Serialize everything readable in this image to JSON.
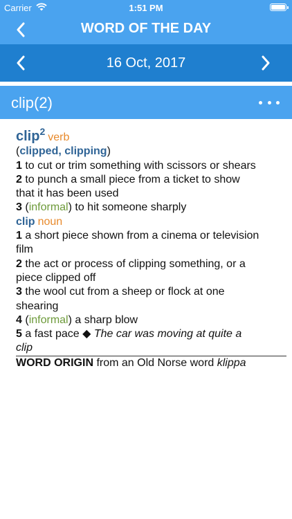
{
  "status": {
    "carrier": "Carrier",
    "time": "1:51 PM",
    "wifi_icon": "wifi-icon",
    "battery_icon": "battery-icon"
  },
  "nav": {
    "title": "WORD OF THE DAY",
    "back_icon": "chevron-left-icon"
  },
  "date_bar": {
    "date": "16 Oct, 2017",
    "prev_icon": "chevron-left-icon",
    "next_icon": "chevron-right-icon"
  },
  "entry": {
    "headword": "clip(2)",
    "more_icon": "more-horizontal-icon"
  },
  "definition": {
    "word": "clip",
    "superscript": "2",
    "pos_verb": "verb",
    "forms_open": "(",
    "forms": "clipped, clipping",
    "forms_close": ")",
    "senses_verb": [
      {
        "num": "1",
        "text": "to cut or trim something with scissors or shears"
      },
      {
        "num": "2",
        "text": "to punch a small piece from a ticket to show",
        "text2": "that it has been used"
      },
      {
        "num": "3",
        "label": "informal",
        "text": "to hit someone sharply"
      }
    ],
    "noun_word": "clip",
    "pos_noun": "noun",
    "senses_noun": [
      {
        "num": "1",
        "text": "a short piece shown from a cinema or television",
        "text2": "film"
      },
      {
        "num": "2",
        "text": "the act or process of clipping something, or a",
        "text2": "piece clipped off"
      },
      {
        "num": "3",
        "text": "the wool cut from a sheep or flock at one",
        "text2": "shearing"
      },
      {
        "num": "4",
        "label": "informal",
        "text": "a sharp blow"
      },
      {
        "num": "5",
        "text": "a fast pace",
        "example": "The car was moving at quite a",
        "example2": "clip"
      }
    ],
    "diamond": "◆",
    "origin_label": "WORD ORIGIN",
    "origin_text": "from an Old Norse word",
    "origin_word": "klippa"
  },
  "colors": {
    "nav_blue": "#4aa3ef",
    "date_blue": "#1f7fcf",
    "headword_blue": "#2f6496",
    "pos_orange": "#e88a2c",
    "label_green": "#6d9a3a"
  }
}
